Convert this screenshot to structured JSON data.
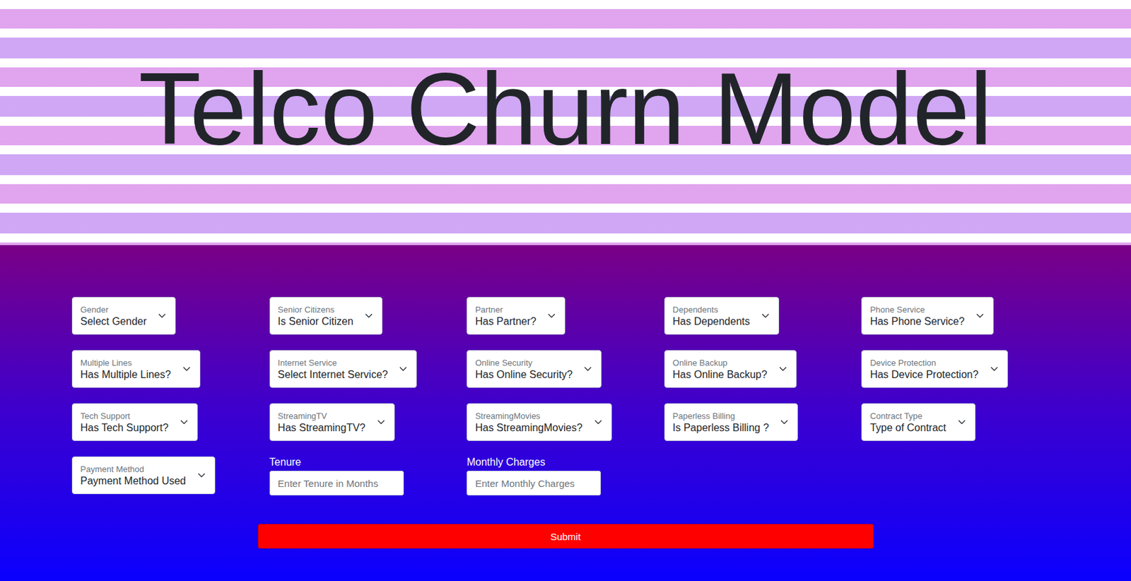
{
  "header": {
    "title": "Telco Churn Model"
  },
  "fields": [
    {
      "kind": "select",
      "label": "Gender",
      "value": "Select Gender"
    },
    {
      "kind": "select",
      "label": "Senior Citizens",
      "value": "Is Senior Citizen"
    },
    {
      "kind": "select",
      "label": "Partner",
      "value": "Has Partner?"
    },
    {
      "kind": "select",
      "label": "Dependents",
      "value": "Has Dependents"
    },
    {
      "kind": "select",
      "label": "Phone Service",
      "value": "Has Phone Service?"
    },
    {
      "kind": "select",
      "label": "Multiple Lines",
      "value": "Has Multiple Lines?"
    },
    {
      "kind": "select",
      "label": "Internet Service",
      "value": "Select Internet Service?"
    },
    {
      "kind": "select",
      "label": "Online Security",
      "value": "Has Online Security?"
    },
    {
      "kind": "select",
      "label": "Online Backup",
      "value": "Has Online Backup?"
    },
    {
      "kind": "select",
      "label": "Device Protection",
      "value": "Has Device Protection?"
    },
    {
      "kind": "select",
      "label": "Tech Support",
      "value": "Has Tech Support?"
    },
    {
      "kind": "select",
      "label": "StreamingTV",
      "value": "Has StreamingTV?"
    },
    {
      "kind": "select",
      "label": "StreamingMovies",
      "value": "Has StreamingMovies?"
    },
    {
      "kind": "select",
      "label": "Paperless Billing",
      "value": "Is Paperless Billing ?"
    },
    {
      "kind": "select",
      "label": "Contract Type",
      "value": "Type of Contract"
    },
    {
      "kind": "select",
      "label": "Payment Method",
      "value": "Payment Method Used"
    },
    {
      "kind": "input",
      "label": "Tenure",
      "placeholder": "Enter Tenure in Months"
    },
    {
      "kind": "input",
      "label": "Monthly Charges",
      "placeholder": "Enter Monthly Charges"
    }
  ],
  "submit": {
    "label": "Submit"
  }
}
